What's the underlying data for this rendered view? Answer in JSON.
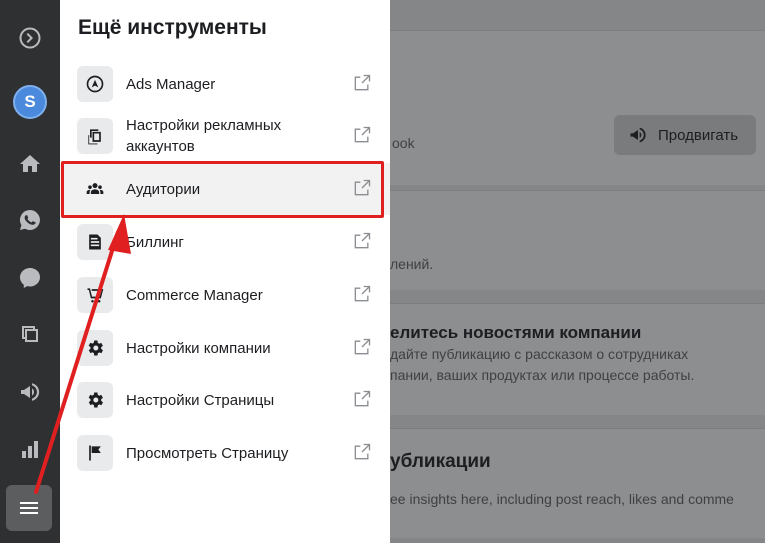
{
  "panel": {
    "title": "Ещё инструменты",
    "items": [
      {
        "label": "Ads Manager",
        "icon": "ads-manager-icon"
      },
      {
        "label": "Настройки рекламных аккаунтов",
        "icon": "ad-account-settings-icon"
      },
      {
        "label": "Аудитории",
        "icon": "audiences-icon"
      },
      {
        "label": "Биллинг",
        "icon": "billing-icon"
      },
      {
        "label": "Commerce Manager",
        "icon": "cart-icon"
      },
      {
        "label": "Настройки компании",
        "icon": "gear-icon"
      },
      {
        "label": "Настройки Страницы",
        "icon": "gear-icon"
      },
      {
        "label": "Просмотреть Страницу",
        "icon": "flag-icon"
      }
    ]
  },
  "rail": {
    "avatar_letter": "S",
    "icons": [
      "meta-logo-icon",
      "home-icon",
      "whatsapp-icon",
      "messenger-icon",
      "pages-icon",
      "megaphone-icon",
      "insights-icon",
      "hamburger-menu-icon"
    ]
  },
  "background": {
    "promote_label": "Продвигать",
    "card1_fragment": "ook",
    "card2_fragment": "лений.",
    "card3_title": "елитесь новостями компании",
    "card3_line1": "дайте публикацию с рассказом о сотрудниках",
    "card3_line2": "пании, ваших продуктах или процессе работы.",
    "card4_title": "убликации",
    "card4_line1": "ee insights here, including post reach, likes and comme"
  },
  "colors": {
    "highlight_border": "#e02020",
    "arrow": "#e02020",
    "avatar": "#4a89dc"
  }
}
